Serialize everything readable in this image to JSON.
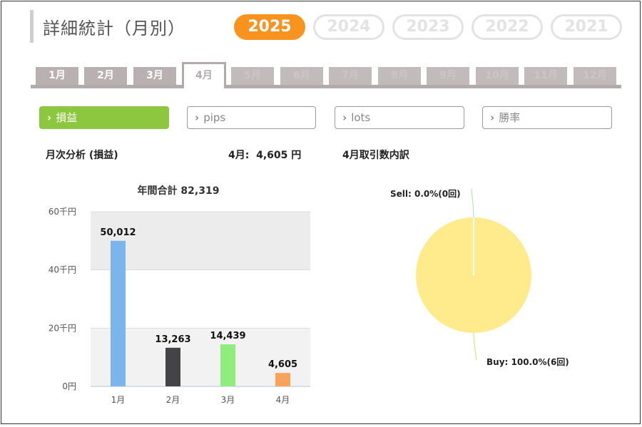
{
  "header": {
    "title": "詳細統計（月別）",
    "years": [
      "2025",
      "2024",
      "2023",
      "2022",
      "2021"
    ],
    "active_year": "2025"
  },
  "month_tabs": [
    "1月",
    "2月",
    "3月",
    "4月",
    "5月",
    "6月",
    "7月",
    "8月",
    "9月",
    "10月",
    "11月",
    "12月"
  ],
  "active_month_index": 3,
  "categories": [
    {
      "label": "損益",
      "active": true
    },
    {
      "label": "pips",
      "active": false
    },
    {
      "label": "lots",
      "active": false
    },
    {
      "label": "勝率",
      "active": false
    }
  ],
  "summary": {
    "monthly_label": "月次分析 (損益)",
    "month_value": "4月:  4,605 円",
    "breakdown_label": "4月取引数内訳"
  },
  "colors": {
    "accent_orange": "#f7931e",
    "accent_green": "#8dc63f",
    "tab_gray": "#b9b1b1"
  },
  "chart_data": [
    {
      "type": "bar",
      "title": "年間合計 82,319",
      "categories": [
        "1月",
        "2月",
        "3月",
        "4月"
      ],
      "values": [
        50012,
        13263,
        14439,
        4605
      ],
      "value_labels": [
        "50,012",
        "13,263",
        "14,439",
        "4,605"
      ],
      "bar_colors": [
        "#7cb5ec",
        "#434348",
        "#90ed7d",
        "#f7a35c"
      ],
      "yticks": [
        0,
        20000,
        40000,
        60000
      ],
      "ytick_labels": [
        "0円",
        "20千円",
        "40千円",
        "60千円"
      ],
      "ylim": [
        0,
        60000
      ],
      "grid": true
    },
    {
      "type": "pie",
      "labels": [
        "Sell",
        "Buy"
      ],
      "values": [
        0,
        6
      ],
      "data_labels": [
        "Sell: 0.0%(0回)",
        "Buy: 100.0%(6回)"
      ],
      "colors": [
        "#a6e3a1",
        "#ffeb8c"
      ]
    }
  ]
}
